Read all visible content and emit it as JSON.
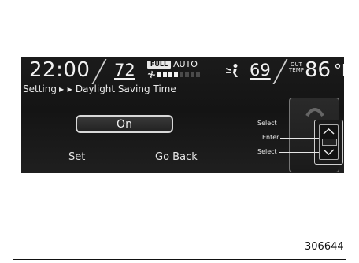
{
  "status_bar": {
    "time": "22:00",
    "driver_temp": "72",
    "fan_mode_badge": "FULL",
    "fan_auto_label": "AUTO",
    "fan_level": 0.5,
    "passenger_temp": "69",
    "outside_label_line1": "OUT",
    "outside_label_line2": "TEMP",
    "outside_temp": "86",
    "outside_unit": "°F",
    "icons": [
      "fan-icon",
      "airflow-icon"
    ]
  },
  "breadcrumb": {
    "parent": "Setting",
    "separator": "▶ ▶",
    "current": "Daylight Saving Time"
  },
  "main": {
    "toggle_value": "On"
  },
  "softkeys": {
    "left": "Set",
    "right": "Go Back"
  },
  "knob": {
    "top_label": "Select",
    "middle_label": "Enter",
    "bottom_label": "Select"
  },
  "figure_number": "306644",
  "colors": {
    "screen_bg": "#181818",
    "text": "#f2f2f2"
  }
}
